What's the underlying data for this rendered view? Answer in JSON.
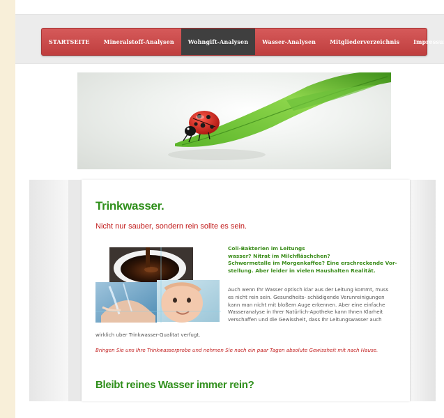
{
  "nav": {
    "items": [
      {
        "label": "STARTSEITE"
      },
      {
        "label": "Mineralstoff-Analysen"
      },
      {
        "label": "Wohngift-Analysen"
      },
      {
        "label": "Wasser-Analysen"
      },
      {
        "label": "Mitgliederverzeichnis"
      },
      {
        "label": "Impressum"
      }
    ],
    "active_index": 2
  },
  "content": {
    "heading": "Trinkwasser.",
    "subheading": "Nicht nur sauber, sondern rein sollte es sein.",
    "lead_lines": [
      "Coli-Bakterien im Leitungs",
      "wasser? Nitrat im Milchfläschchen?",
      "Schwermetalle im Morgenkaffee? Eine erschreckende Vor-",
      "stellung. Aber leider in vielen Haushalten Realität."
    ],
    "body_lines": [
      "Auch wenn Ihr Wasser optisch klar aus der Leitung kommt, muss",
      "es nicht rein sein. Gesundheits- schädigende Verunreinigungen",
      "kann man nicht mit bloßem Auge erkennen. Aber eine einfache",
      "Wasseranalyse in Ihrer Natürlich-Apotheke kann Ihnen Klarheit",
      "verschaffen und die Gewissheit, dass Ihr Leitungswasser auch"
    ],
    "body_tail": "wirklich uber Trinkwasser-Qualitat verfugt.",
    "italic_note": "Bringen Sie uns Ihre Trinkwasserprobe und nehmen Sie nach ein paar Tagen absolute Gewissheit mit nach Hause.",
    "heading2": "Bleibt reines Wasser immer rein?"
  },
  "colors": {
    "nav": "#c94a4a",
    "nav_active": "#3f3f3f",
    "heading_green": "#2f8f1b",
    "accent_red": "#c11b1b",
    "background": "#f8efd9"
  }
}
